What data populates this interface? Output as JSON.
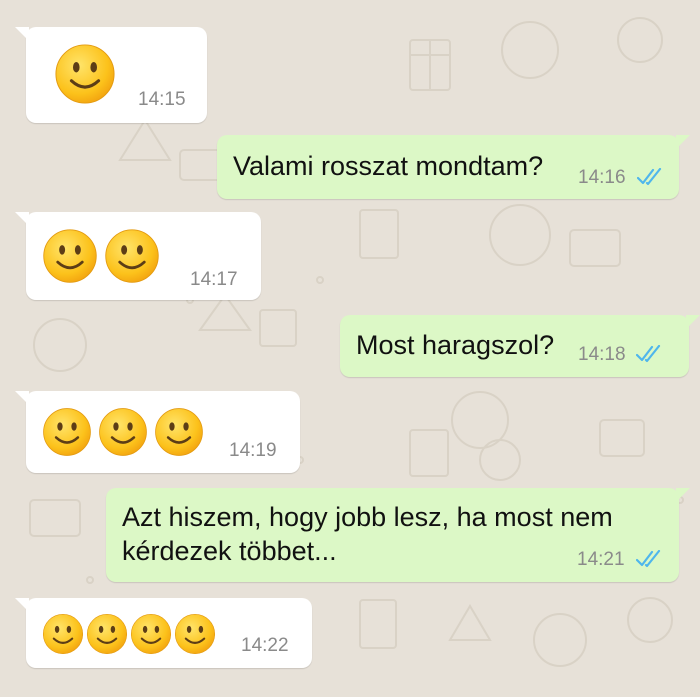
{
  "colors": {
    "background": "#e7e1d8",
    "incoming_bubble": "#ffffff",
    "outgoing_bubble": "#dcf8c6",
    "read_ticks": "#4fb6ec",
    "timestamp": "#8a8a8a"
  },
  "messages": [
    {
      "direction": "incoming",
      "emoji": "slightly-smiling-face-icon",
      "emoji_count": 1,
      "time": "14:15"
    },
    {
      "direction": "outgoing",
      "text": "Valami rosszat mondtam?",
      "time": "14:16",
      "status": "read"
    },
    {
      "direction": "incoming",
      "emoji": "slightly-smiling-face-icon",
      "emoji_count": 2,
      "time": "14:17"
    },
    {
      "direction": "outgoing",
      "text": "Most haragszol?",
      "time": "14:18",
      "status": "read"
    },
    {
      "direction": "incoming",
      "emoji": "slightly-smiling-face-icon",
      "emoji_count": 3,
      "time": "14:19"
    },
    {
      "direction": "outgoing",
      "text": "Azt hiszem, hogy jobb lesz, ha most nem kérdezek többet...",
      "time": "14:21",
      "status": "read"
    },
    {
      "direction": "incoming",
      "emoji": "slightly-smiling-face-icon",
      "emoji_count": 4,
      "time": "14:22"
    }
  ]
}
